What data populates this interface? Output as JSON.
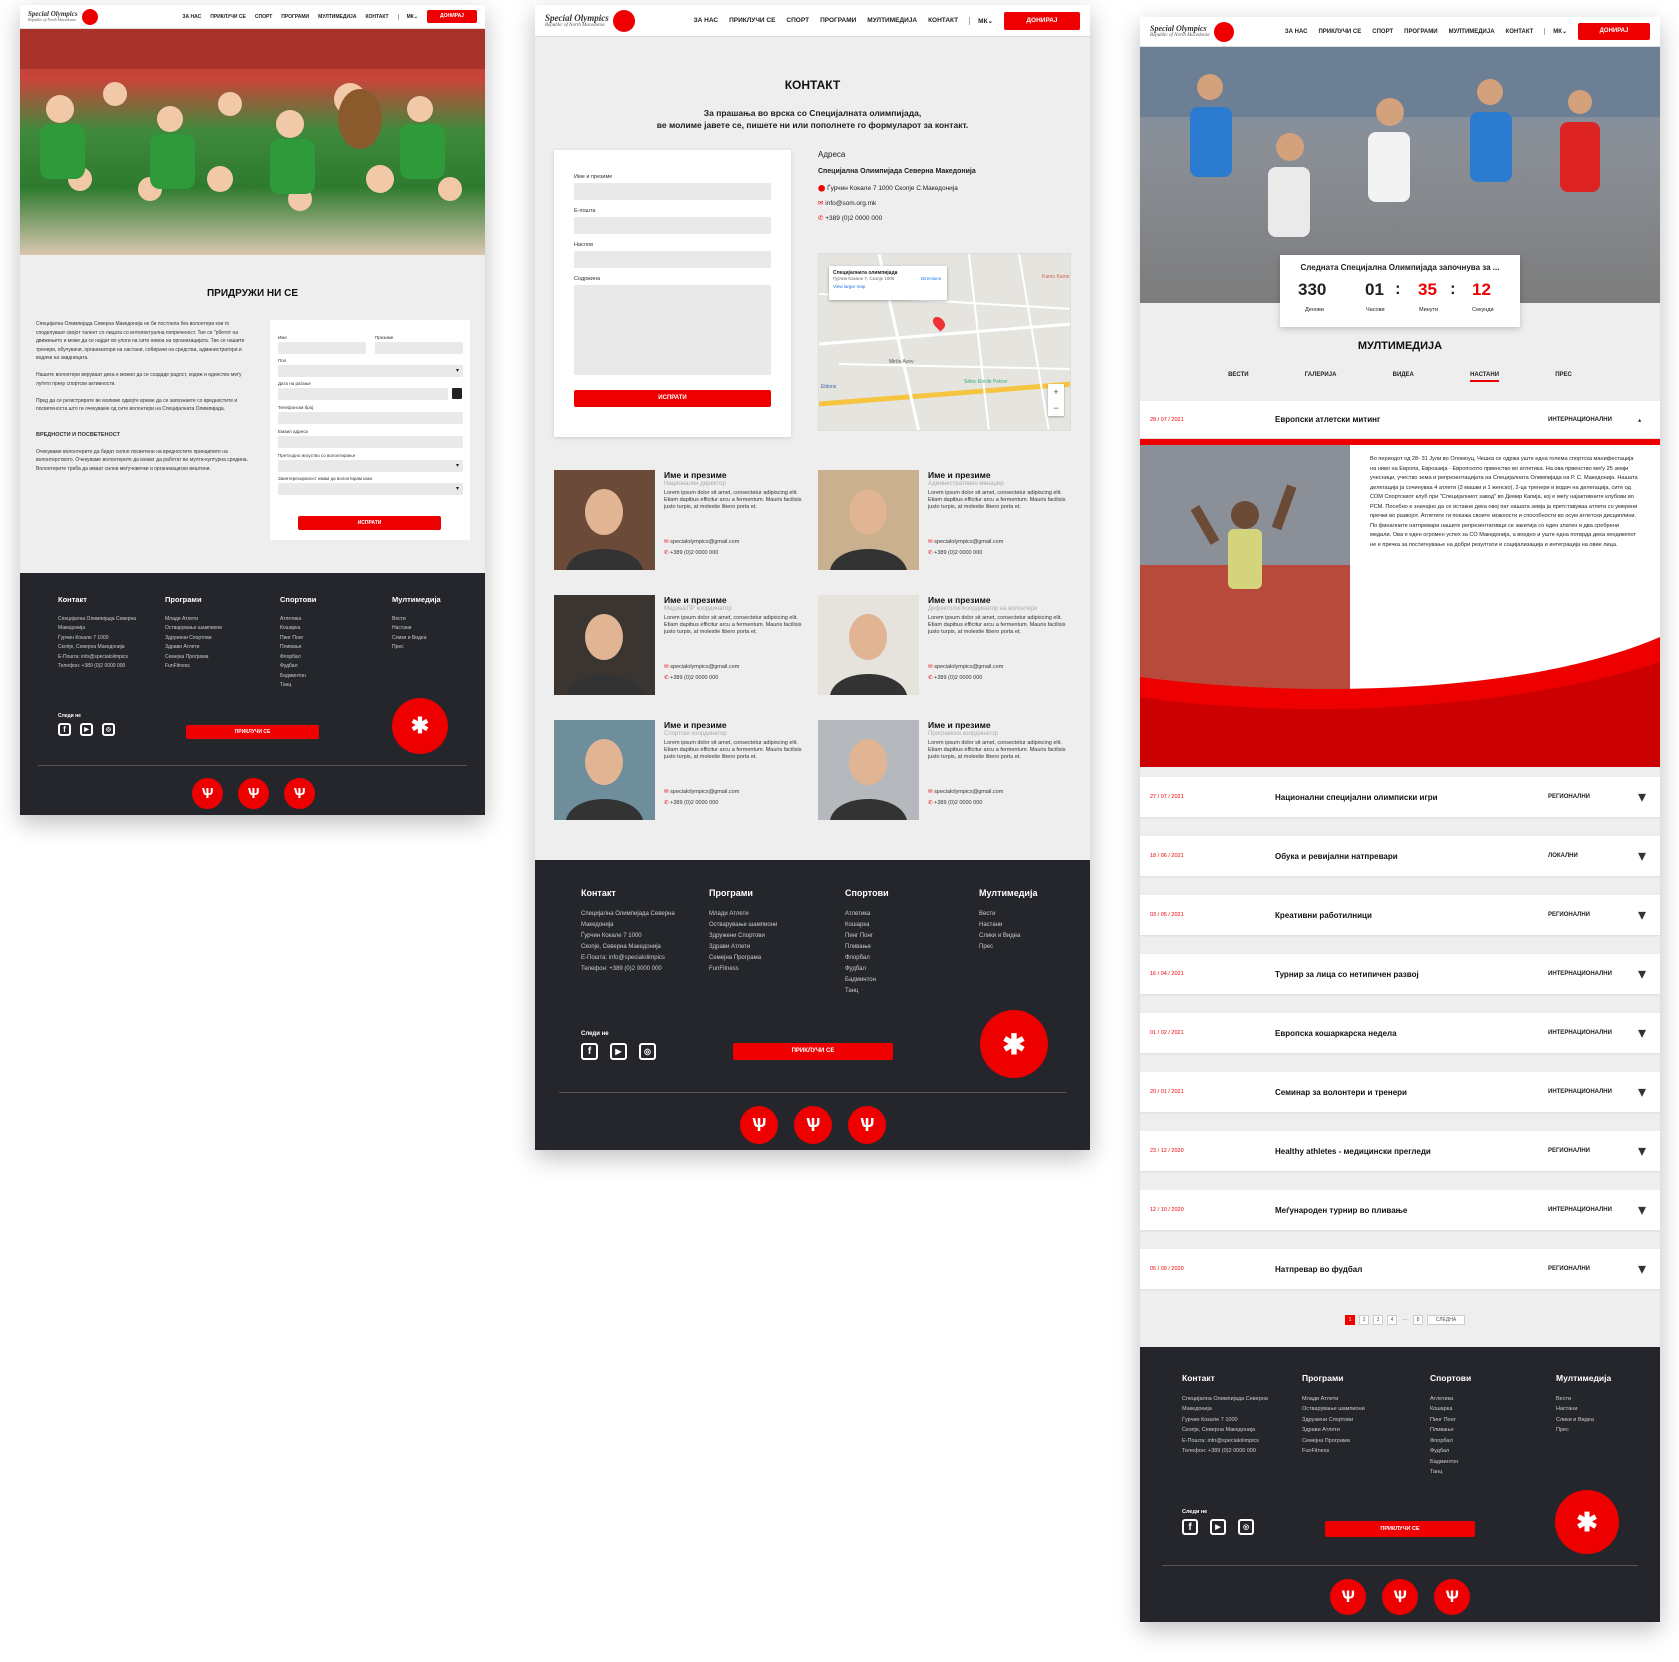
{
  "header": {
    "logo_title": "Special Olympics",
    "logo_sub": "Republic of North Macedonia",
    "nav": [
      "ЗА НАС",
      "ПРИКЛУЧИ СЕ",
      "СПОРТ",
      "ПРОГРАМИ",
      "МУЛТИМЕДИЈА",
      "КОНТАКТ"
    ],
    "lang": "МК",
    "donate": "ДОНИРАЈ"
  },
  "join": {
    "title": "ПРИДРУЖИ НИ СЕ",
    "p1": "Специјална Олимпијада Северна Македонија не би постоела без волонтери кои го споделуваат својот талент со лицата со интелектуална попреченост. Тие се \"рбетот на движењето и може да се најдат во улоги на сите нивоа на организацијата. Тие се нашите тренери, обучувачи, организатори на настани, собирачи на средства, администратори и водачи на завдницата.",
    "p2": "Нашите волонтери веруваат дека е можно да се создаде радост, кодеж и единство меѓу луѓето преку спортски активности.",
    "p3": "Пред да се регистрирате ве молиме одвојте време да се запознаете со вредностите и посветеноста што ги очекуваме од сите волонтери на Специјалната Олимпијада.",
    "values_title": "ВРЕДНОСТИ И ПОСВЕТЕНОСТ",
    "p4": "Очекуваме волонтерите да бидат силно посветени на вредностите принципите на волонтерството. Очекуваме волонтерите да можат да работат во мулти-културна средина. Волонтерите треба да имаат силни меѓучовечки и организациски вештини.",
    "form": {
      "first": "Име",
      "last": "Презиме",
      "gender": "Пол",
      "dob": "Дата на раѓање",
      "phone": "Телефонски број",
      "email": "Емаил адреса",
      "exp": "Претходно искуство со волонтирање",
      "interest": "Заинтересираност имам да волонтирам како",
      "submit": "ИСПРАТИ"
    }
  },
  "contact": {
    "title": "КОНТАКТ",
    "intro1": "За прашања во врска со Специјалната олимпијада,",
    "intro2": "ве молиме јавете се, пишете ни или пополнете го формуларот за контакт.",
    "form": {
      "name": "Име и презиме",
      "email": "E-пошта",
      "subject": "Наслов",
      "content": "Содржина",
      "submit": "ИСПРАТИ"
    },
    "address_label": "Адреса",
    "org": "Специјална Олимпијада Северна Македонија",
    "street": "Ѓурчин Кокале 7 1000 Скопје С.Македонија",
    "mail": "info@som.org.mk",
    "phone": "+389 (0)2 0000 000",
    "map": {
      "card_title": "Специјалната олимпијада",
      "card_sub": "Гурчин Кокале 7, Скопје 1000",
      "card_link": "View larger map",
      "directions": "Directions",
      "p1": "Kamo Kamo",
      "p2": "Mirče Acev",
      "p3": "Sélec Đorđe Petrov",
      "p4": "Eldons"
    },
    "staff": [
      {
        "name": "Име и презиме",
        "role": "Национален директор",
        "desc": "Lorem ipsum dolor sit amet, consectetur adipiscing elit. Etiam dapibus efficitur arcu a fermentum. Mauris facilisis justo turpis, at molestie libero porta et.",
        "email": "specialolympics@gmail.com",
        "phone": "+389 (0)2 0000 000"
      },
      {
        "name": "Име и презиме",
        "role": "Административен менаџер",
        "desc": "Lorem ipsum dolor sit amet, consectetur adipiscing elit. Etiam dapibus efficitur arcu a fermentum. Mauris facilisis justo turpis, at molestie libero porta et.",
        "email": "specialolympics@gmail.com",
        "phone": "+389 (0)2 0000 000"
      },
      {
        "name": "Име и презиме",
        "role": "Медиа&ПР координатор",
        "desc": "Lorem ipsum dolor sit amet, consectetur adipiscing elit. Etiam dapibus efficitur arcu a fermentum. Mauris facilisis justo turpis, at molestie libero porta et.",
        "email": "specialolympics@gmail.com",
        "phone": "+389 (0)2 0000 000"
      },
      {
        "name": "Име и презиме",
        "role": "Дефектолог/координатор на волонтери",
        "desc": "Lorem ipsum dolor sit amet, consectetur adipiscing elit. Etiam dapibus efficitur arcu a fermentum. Mauris facilisis justo turpis, at molestie libero porta et.",
        "email": "specialolympics@gmail.com",
        "phone": "+389 (0)2 0000 000"
      },
      {
        "name": "Име и презиме",
        "role": "Спортски координатор",
        "desc": "Lorem ipsum dolor sit amet, consectetur adipiscing elit. Etiam dapibus efficitur arcu a fermentum. Mauris facilisis justo turpis, at molestie libero porta et.",
        "email": "specialolympics@gmail.com",
        "phone": "+389 (0)2 0000 000"
      },
      {
        "name": "Име и презиме",
        "role": "Програмски координатор",
        "desc": "Lorem ipsum dolor sit amet, consectetur adipiscing elit. Etiam dapibus efficitur arcu a fermentum. Mauris facilisis justo turpis, at molestie libero porta et.",
        "email": "specialolympics@gmail.com",
        "phone": "+389 (0)2 0000 000"
      }
    ]
  },
  "footer": {
    "contact_title": "Контакт",
    "contact": [
      "Специјална Олимпијада Северна Македонија",
      "Ѓурчин Кокале 7 1000",
      "Скопје, Северна Македонија",
      "Е-Пошта: info@specialolimpics",
      "Телефон: +389 (0)2 0000 000"
    ],
    "programs_title": "Програми",
    "programs": [
      "Млади Атлети",
      "Остварување шампиони",
      "Здружени Спортови",
      "Здрави Атлети",
      "Семејна Програма",
      "FunFitness"
    ],
    "sports_title": "Спортови",
    "sports": [
      "Атлетика",
      "Кошарка",
      "Пинг Понг",
      "Пливање",
      "Флорбал",
      "Фудбал",
      "Бадминтон",
      "Танц"
    ],
    "media_title": "Мултимедија",
    "media": [
      "Вести",
      "Настани",
      "Слики и Видеа",
      "Прес"
    ],
    "follow": "Следи не",
    "join_btn": "ПРИКЛУЧИ СЕ"
  },
  "countdown": {
    "title": "Следната Специјална Олимпијада започнува за ...",
    "days": "330",
    "days_l": "Денови",
    "hours": "01",
    "hours_l": "Часови",
    "mins": "35",
    "mins_l": "Минути",
    "secs": "12",
    "secs_l": "Секунди"
  },
  "multimedia": {
    "title": "МУЛТИМЕДИЈА",
    "tabs": [
      "ВЕСТИ",
      "ГАЛЕРИЈА",
      "ВИДЕА",
      "НАСТАНИ",
      "ПРЕС"
    ],
    "active_tab": 3,
    "expanded": {
      "date": "28 / 07 / 2021",
      "title": "Европски атлетски митинг",
      "cat": "ИНТЕРНАЦИОНАЛНИ",
      "text": "Во периодот од 28- 31 Јули во Оломоуц, Чешка се одржа уште една голема спортска манифестација на ниво на Европа, Евроазија - Европското првенство во атлетика. На ова првенство меѓу 25 земји учесници, учество зема и репрезентацијата на Специјалната Олимпијада на Р. С. Македонија. Нашата делегација ја сочинуваа 4 атлети (3 машки и 1 женско), 2-ца тренери и водач на делегација, сите од СОМ Спортскиот клуб при \"Специјалниот завод\" во Демир Капија, кој е меѓу најактивните клубови во РСМ. Посебно е значајно да се истакне дека овој пат нашата земја ја претставуваа атлети со умерени пречки во развојот. Атлетите ги покажа своите можности и способности во осум атлетски дисциплини. По финалните натпревари нашите репрезентативци се закитија со еден златен и два сребрени медали. Ова е еден огромен успех за СО Македонија, а воедно и уште една потврда дека хендикепот не е пречка за постигнување на добри резултати и социјализација и интеграција на овие лица."
    },
    "events": [
      {
        "date": "27 / 07 / 2021",
        "title": "Национални специјални олимписки игри",
        "cat": "РЕГИОНАЛНИ"
      },
      {
        "date": "18 / 06 / 2021",
        "title": "Обука и ревијални натпревари",
        "cat": "ЛОКАЛНИ"
      },
      {
        "date": "03 / 05 / 2021",
        "title": "Креативни работилници",
        "cat": "РЕГИОНАЛНИ"
      },
      {
        "date": "16 / 04 / 2021",
        "title": "Турнир за лица со нетипичен развој",
        "cat": "ИНТЕРНАЦИОНАЛНИ"
      },
      {
        "date": "01 / 02 / 2021",
        "title": "Европска кошаркарска недела",
        "cat": "ИНТЕРНАЦИОНАЛНИ"
      },
      {
        "date": "20 / 01 / 2021",
        "title": "Семинар за волонтери и тренери",
        "cat": "ИНТЕРНАЦИОНАЛНИ"
      },
      {
        "date": "23 / 12 / 2020",
        "title": "Healthy athletes - медицински прегледи",
        "cat": "РЕГИОНАЛНИ"
      },
      {
        "date": "12 / 10 / 2020",
        "title": "Меѓународен турнир во пливање",
        "cat": "ИНТЕРНАЦИОНАЛНИ"
      },
      {
        "date": "05 / 09 / 2020",
        "title": "Натпревар во фудбал",
        "cat": "РЕГИОНАЛНИ"
      }
    ],
    "pagination": [
      "1",
      "2",
      "3",
      "4",
      "...",
      "8"
    ],
    "next": "СЛЕДНА"
  },
  "colors": {
    "accent": "#e00000",
    "footer": "#24262b",
    "page_bg": "#eeeeee"
  }
}
